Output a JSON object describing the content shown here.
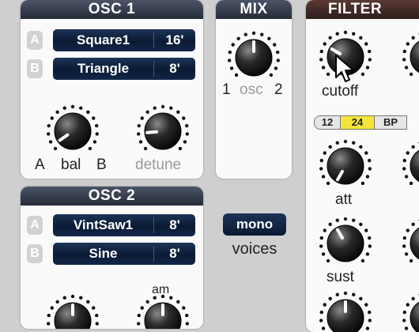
{
  "osc1": {
    "title": "OSC 1",
    "rows": [
      {
        "slot": "A",
        "wave": "Square1",
        "feet": "16'"
      },
      {
        "slot": "B",
        "wave": "Triangle",
        "feet": "8'"
      }
    ],
    "bal_left": "A",
    "bal_label": "bal",
    "bal_right": "B",
    "detune_label": "detune"
  },
  "osc2": {
    "title": "OSC 2",
    "rows": [
      {
        "slot": "A",
        "wave": "VintSaw1",
        "feet": "8'"
      },
      {
        "slot": "B",
        "wave": "Sine",
        "feet": "8'"
      }
    ],
    "am_label": "am"
  },
  "mix": {
    "title": "MIX",
    "left": "1",
    "mid": "osc",
    "right": "2"
  },
  "voices": {
    "button": "mono",
    "label": "voices"
  },
  "filter": {
    "title": "FILTER",
    "cutoff_label": "cutoff",
    "modes": [
      "12",
      "24",
      "BP"
    ],
    "active_mode": "24",
    "att_label": "att",
    "sust_label": "sust"
  },
  "colors": {
    "header": "#2f3645",
    "filter_header": "#3a2624",
    "wave_button": "#0f2142",
    "mode_active": "#f5e53a"
  }
}
